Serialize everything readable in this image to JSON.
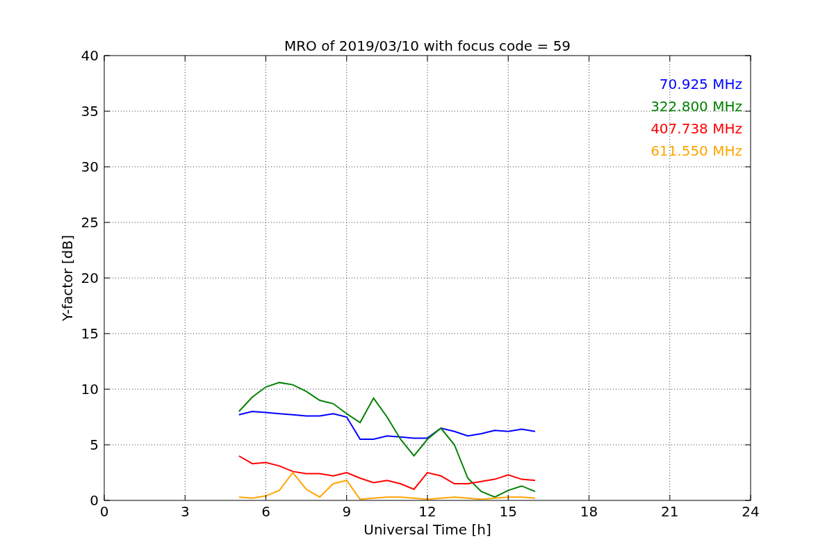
{
  "chart_data": {
    "type": "line",
    "title": "MRO of 2019/03/10 with focus code = 59",
    "xlabel": "Universal Time [h]",
    "ylabel": "Y-factor [dB]",
    "x": [
      5,
      5.5,
      6,
      6.5,
      7,
      7.5,
      8,
      8.5,
      9,
      9.5,
      10,
      10.5,
      11,
      11.5,
      12,
      12.5,
      13,
      13.5,
      14,
      14.5,
      15,
      15.5,
      16
    ],
    "series": [
      {
        "name": "70.925 MHz",
        "color": "#0000ff",
        "values": [
          7.7,
          8.0,
          7.9,
          7.8,
          7.7,
          7.6,
          7.6,
          7.8,
          7.5,
          5.5,
          5.5,
          5.8,
          5.7,
          5.6,
          5.6,
          6.5,
          6.2,
          5.8,
          6.0,
          6.3,
          6.2,
          6.4,
          6.2
        ]
      },
      {
        "name": "322.800 MHz",
        "color": "#008000",
        "values": [
          8.0,
          9.3,
          10.2,
          10.6,
          10.4,
          9.8,
          9.0,
          8.7,
          7.8,
          7.0,
          9.2,
          7.5,
          5.5,
          4.0,
          5.5,
          6.5,
          5.0,
          2.0,
          0.8,
          0.3,
          0.9,
          1.3,
          0.8
        ]
      },
      {
        "name": "407.738 MHz",
        "color": "#ff0000",
        "values": [
          4.0,
          3.3,
          3.4,
          3.1,
          2.6,
          2.4,
          2.4,
          2.2,
          2.5,
          2.0,
          1.6,
          1.8,
          1.5,
          1.0,
          2.5,
          2.2,
          1.5,
          1.5,
          1.7,
          1.9,
          2.3,
          1.9,
          1.8
        ]
      },
      {
        "name": "611.550 MHz",
        "color": "#ffa500",
        "values": [
          0.3,
          0.2,
          0.4,
          0.9,
          2.5,
          1.0,
          0.3,
          1.5,
          1.8,
          0.1,
          0.2,
          0.3,
          0.3,
          0.2,
          0.1,
          0.2,
          0.3,
          0.2,
          0.1,
          0.2,
          0.3,
          0.3,
          0.2
        ]
      }
    ],
    "grid": true,
    "xlim": [
      0,
      24
    ],
    "ylim": [
      0,
      40
    ],
    "xticks": [
      0,
      3,
      6,
      9,
      12,
      15,
      18,
      21,
      24
    ],
    "yticks": [
      0,
      5,
      10,
      15,
      20,
      25,
      30,
      35,
      40
    ]
  }
}
